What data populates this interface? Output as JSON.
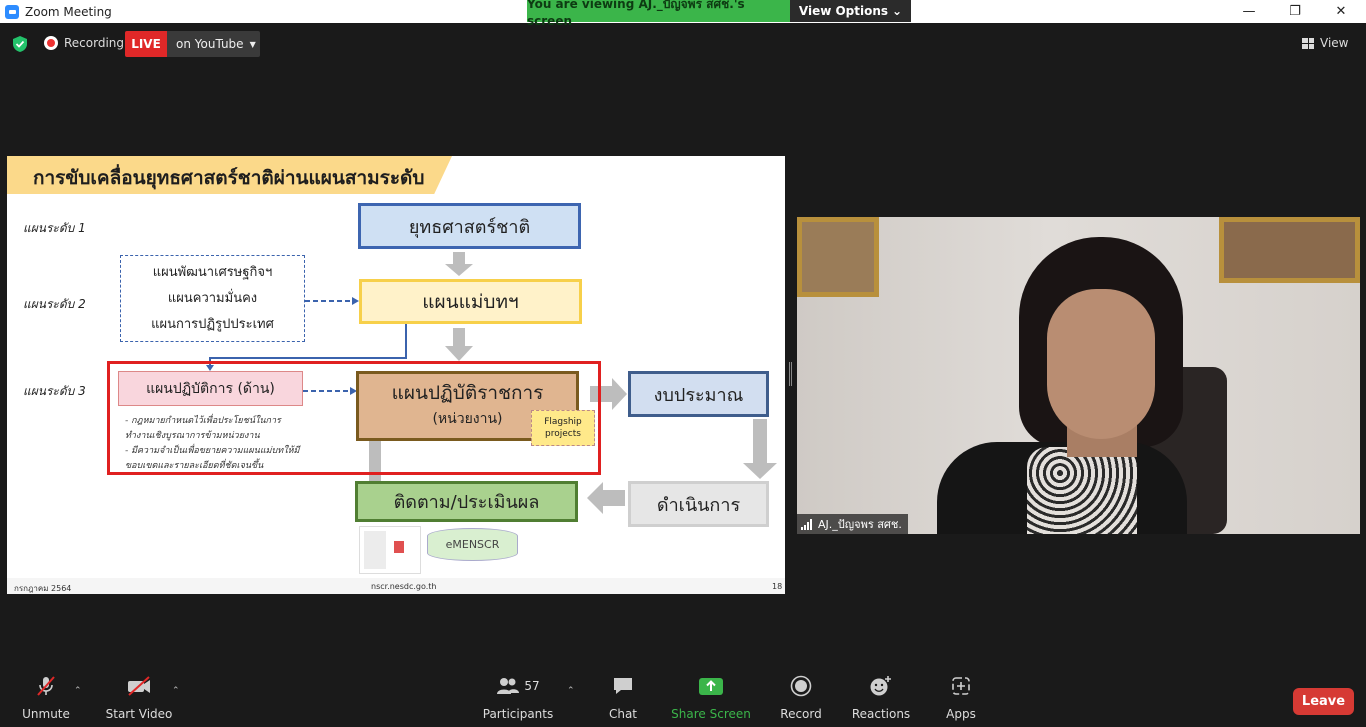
{
  "window": {
    "title": "Zoom Meeting"
  },
  "banner": {
    "viewing": "You are viewing AJ._ปัญจพร สศช.'s screen",
    "view_options": "View Options"
  },
  "status": {
    "recording": "Recording",
    "live": "LIVE",
    "live_target": "on YouTube",
    "view": "View"
  },
  "slide": {
    "title": "การขับเคลื่อนยุทธศาสตร์ชาติผ่านแผนสามระดับ",
    "levels": [
      "แผนระดับ 1",
      "แผนระดับ 2",
      "แผนระดับ 3"
    ],
    "national_strategy": "ยุทธศาสตร์ชาติ",
    "master_plan": "แผนแม่บทฯ",
    "other_plans": [
      "แผนพัฒนาเศรษฐกิจฯ",
      "แผนความมั่นคง",
      "แผนการปฏิรูปประเทศ"
    ],
    "action_plan": "แผนปฏิบัติการ (ด้าน)",
    "gov_plan": "แผนปฏิบัติราชการ",
    "gov_plan_sub": "(หน่วยงาน)",
    "flagship": "Flagship projects",
    "budget": "งบประมาณ",
    "execute": "ดำเนินการ",
    "monitor": "ติดตาม/ประเมินผล",
    "emenscr": "eMENSCR",
    "notes": [
      "- กฎหมายกำหนดไว้เพื่อประโยชน์ในการ",
      "ทำงานเชิงบูรณาการข้ามหน่วยงาน",
      "- มีความจำเป็นเพื่อขยายความแผนแม่บทให้มี",
      "ขอบเขตและรายละเอียดที่ชัดเจนขึ้น"
    ],
    "footer_left": "กรกฎาคม 2564",
    "footer_mid": "nscr.nesdc.go.th",
    "footer_right": "18"
  },
  "video": {
    "participant_name": "AJ._ปัญจพร สศช."
  },
  "toolbar": {
    "unmute": "Unmute",
    "start_video": "Start Video",
    "participants": "Participants",
    "participants_count": "57",
    "chat": "Chat",
    "share_screen": "Share Screen",
    "record": "Record",
    "reactions": "Reactions",
    "apps": "Apps",
    "leave": "Leave"
  },
  "colors": {
    "share_green": "#3bb54a",
    "leave_red": "#d63a34",
    "live_red": "#e02828"
  }
}
